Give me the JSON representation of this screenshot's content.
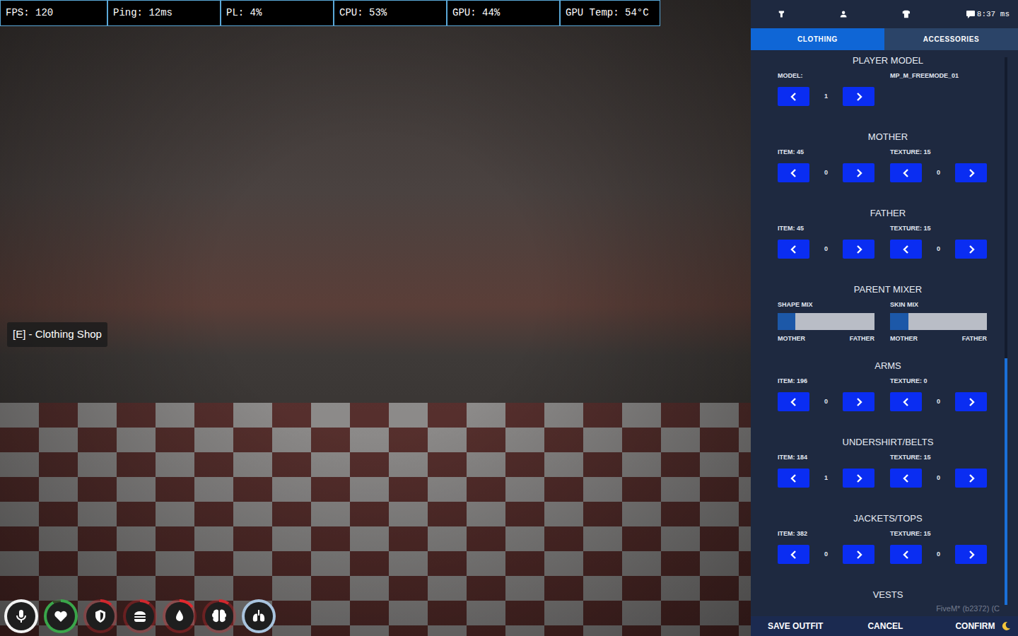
{
  "stats_bar": [
    {
      "text": "FPS: 120"
    },
    {
      "text": "Ping: 12ms"
    },
    {
      "text": "PL: 4%"
    },
    {
      "text": "CPU: 53%"
    },
    {
      "text": "GPU: 44%"
    },
    {
      "text": "GPU Temp: 54°C"
    }
  ],
  "prompt": "[E] - Clothing Shop",
  "hud": [
    {
      "kind": "voice",
      "level": 1,
      "color": "#f2f2f2"
    },
    {
      "kind": "health",
      "level": 0.92,
      "color": "#3aa64a"
    },
    {
      "kind": "armor",
      "level": 0.12,
      "color": "#d0282e"
    },
    {
      "kind": "hunger",
      "level": 0.1,
      "color": "#d0282e"
    },
    {
      "kind": "thirst",
      "level": 0.15,
      "color": "#e0282e"
    },
    {
      "kind": "stress",
      "level": 0.1,
      "color": "#d0282e"
    },
    {
      "kind": "oxygen",
      "level": 1,
      "color": "#a9c4de"
    }
  ],
  "panel": {
    "latency": "8:37 ms",
    "tabs": [
      {
        "label": "CLOTHING",
        "selected": true
      },
      {
        "label": "ACCESSORIES",
        "selected": false
      }
    ],
    "sections": [
      {
        "kind": "model",
        "title": "PLAYER MODEL",
        "label": "MODEL:",
        "value": "MP_M_FREEMODE_01",
        "stepper": "1"
      },
      {
        "kind": "pair",
        "title": "MOTHER",
        "item_label": "ITEM: 45",
        "item_value": "0",
        "texture_label": "TEXTURE: 15",
        "texture_value": "0"
      },
      {
        "kind": "pair",
        "title": "FATHER",
        "item_label": "ITEM: 45",
        "item_value": "0",
        "texture_label": "TEXTURE: 15",
        "texture_value": "0"
      },
      {
        "kind": "mixer",
        "title": "PARENT MIXER",
        "sliders": [
          {
            "label": "SHAPE MIX",
            "level": 0.18,
            "left": "MOTHER",
            "right": "FATHER"
          },
          {
            "label": "SKIN MIX",
            "level": 0.19,
            "left": "MOTHER",
            "right": "FATHER"
          }
        ]
      },
      {
        "kind": "pair",
        "title": "ARMS",
        "item_label": "ITEM: 196",
        "item_value": "0",
        "texture_label": "TEXTURE: 0",
        "texture_value": "0"
      },
      {
        "kind": "pair",
        "title": "UNDERSHIRT/BELTS",
        "item_label": "ITEM: 184",
        "item_value": "1",
        "texture_label": "TEXTURE: 15",
        "texture_value": "0"
      },
      {
        "kind": "pair",
        "title": "JACKETS/TOPS",
        "item_label": "ITEM: 382",
        "item_value": "0",
        "texture_label": "TEXTURE: 15",
        "texture_value": "0"
      },
      {
        "kind": "heading",
        "title": "VESTS"
      }
    ],
    "watermark": "FiveM* (b2372) (C",
    "footer": [
      {
        "label": "SAVE OUTFIT"
      },
      {
        "label": "CANCEL"
      },
      {
        "label": "CONFIRM"
      }
    ]
  }
}
